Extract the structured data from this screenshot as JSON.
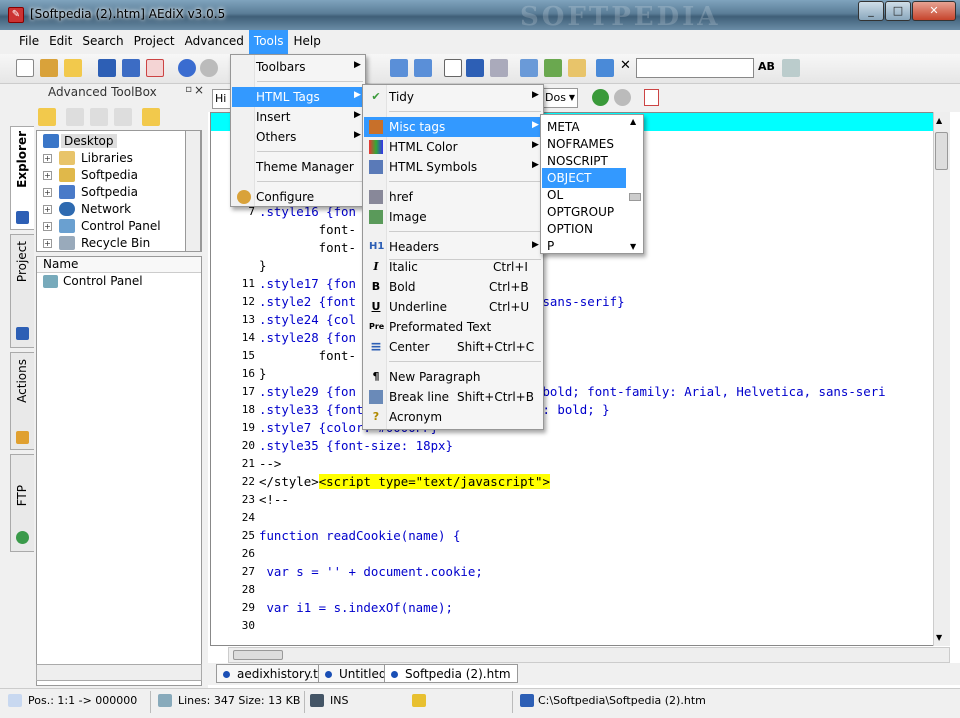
{
  "window": {
    "title": "[Softpedia (2).htm] AEdiX v3.0.5",
    "watermark": "SOFTPEDIA",
    "minimize": "_",
    "maximize": "□",
    "close": "✕"
  },
  "menubar": [
    "File",
    "Edit",
    "Search",
    "Project",
    "Advanced",
    "Tools",
    "Help"
  ],
  "toolbar": {
    "search_value": ""
  },
  "toolbox": {
    "title": "Advanced ToolBox",
    "pin": "▫",
    "close": "×",
    "tabs": [
      "Explorer",
      "Project",
      "Actions",
      "FTP"
    ],
    "tree": [
      {
        "label": "Desktop",
        "icon": "desktop-icon",
        "expander": false
      },
      {
        "label": "Libraries",
        "icon": "libraries-icon",
        "expander": true
      },
      {
        "label": "Softpedia",
        "icon": "user-folder-icon",
        "expander": true
      },
      {
        "label": "Softpedia",
        "icon": "computer-icon",
        "expander": true
      },
      {
        "label": "Network",
        "icon": "network-icon",
        "expander": true
      },
      {
        "label": "Control Panel",
        "icon": "control-panel-icon",
        "expander": true
      },
      {
        "label": "Recycle Bin",
        "icon": "recycle-bin-icon",
        "expander": true
      }
    ],
    "filelist_header": "Name",
    "files": [
      "Control Panel"
    ]
  },
  "editor_bar": {
    "partial_left": "Hi",
    "doctype_partial": "Dos"
  },
  "code": {
    "lines": [
      {
        "n": "",
        "text": ""
      },
      {
        "n": "",
        "text": "ml; charset=iso-8859-1\" />"
      },
      {
        "n": "",
        "text": ""
      },
      {
        "n": "",
        "text": ""
      },
      {
        "n": "",
        "text": "<!--"
      },
      {
        "n": "7",
        "text": ".style16 {fon"
      },
      {
        "n": "",
        "text": "        font-"
      },
      {
        "n": "",
        "text": "        font-"
      },
      {
        "n": "",
        "text": "}"
      },
      {
        "n": "11",
        "text": ".style17 {fon"
      },
      {
        "n": "12",
        "text": ".style2 {font                     ca, sans-serif}"
      },
      {
        "n": "13",
        "text": ".style24 {col"
      },
      {
        "n": "14",
        "text": ".style28 {fon"
      },
      {
        "n": "15",
        "text": "        font-"
      },
      {
        "n": "16",
        "text": "}"
      },
      {
        "n": "17",
        "text": ".style29 {fon                    ght: bold; font-family: Arial, Helvetica, sans-seri"
      },
      {
        "n": "18",
        "text": ".style33 {font-size: 18px; font-weight: bold; }"
      },
      {
        "n": "19",
        "text": ".style7 {color: #0000FF}"
      },
      {
        "n": "20",
        "text": ".style35 {font-size: 18px}"
      },
      {
        "n": "21",
        "text": "-->"
      },
      {
        "n": "22",
        "text": "</style>",
        "hl": "<script type=\"text/javascript\">"
      },
      {
        "n": "23",
        "text": "<!--"
      },
      {
        "n": "24",
        "text": ""
      },
      {
        "n": "25",
        "text": "function readCookie(name) {"
      },
      {
        "n": "26",
        "text": ""
      },
      {
        "n": "27",
        "text": " var s = '' + document.cookie;"
      },
      {
        "n": "28",
        "text": ""
      },
      {
        "n": "29",
        "text": " var i1 = s.indexOf(name);"
      },
      {
        "n": "30",
        "text": ""
      }
    ]
  },
  "doc_tabs": [
    "aedixhistory.txt",
    "Untitled",
    "Softpedia (2).htm"
  ],
  "status": {
    "pos": "Pos.: 1:1 -> 000000",
    "lines": "Lines: 347 Size: 13 KB",
    "mode": "INS",
    "path": "C:\\Softpedia\\Softpedia (2).htm"
  },
  "menu_tools": [
    {
      "label": "Toolbars",
      "arrow": true
    },
    {
      "label": "HTML Tags",
      "arrow": true,
      "hot": true
    },
    {
      "label": "Insert",
      "arrow": true
    },
    {
      "label": "Others",
      "arrow": true
    },
    {
      "label": "Theme Manager"
    },
    {
      "label": "Configure"
    }
  ],
  "menu_html_tags": [
    {
      "label": "Tidy",
      "arrow": true,
      "icon": "✔"
    },
    {
      "label": "Misc tags",
      "arrow": true,
      "hot": true
    },
    {
      "label": "HTML Color",
      "arrow": true
    },
    {
      "label": "HTML Symbols",
      "arrow": true
    },
    {
      "label": "href"
    },
    {
      "label": "Image"
    },
    {
      "label": "Headers",
      "arrow": true,
      "icon": "H1"
    },
    {
      "label": "Italic",
      "shortcut": "Ctrl+I",
      "icon": "I"
    },
    {
      "label": "Bold",
      "shortcut": "Ctrl+B",
      "icon": "B"
    },
    {
      "label": "Underline",
      "shortcut": "Ctrl+U",
      "icon": "U"
    },
    {
      "label": "Preformated Text",
      "icon": "Pre"
    },
    {
      "label": "Center",
      "shortcut": "Shift+Ctrl+C",
      "icon": "≡"
    },
    {
      "label": "New Paragraph",
      "icon": "¶"
    },
    {
      "label": "Break line",
      "shortcut": "Shift+Ctrl+B"
    },
    {
      "label": "Acronym",
      "icon": "?"
    }
  ],
  "menu_misc_tags": [
    "META",
    "NOFRAMES",
    "NOSCRIPT",
    "OBJECT",
    "OL",
    "OPTGROUP",
    "OPTION",
    "P"
  ],
  "menu_misc_tags_selected": "OBJECT",
  "misc_scroll_up": "▲",
  "misc_scroll_down": "▼",
  "colors": {
    "accent": "#3399ff",
    "current_line": "#00ffff",
    "highlight": "#ffff00"
  }
}
